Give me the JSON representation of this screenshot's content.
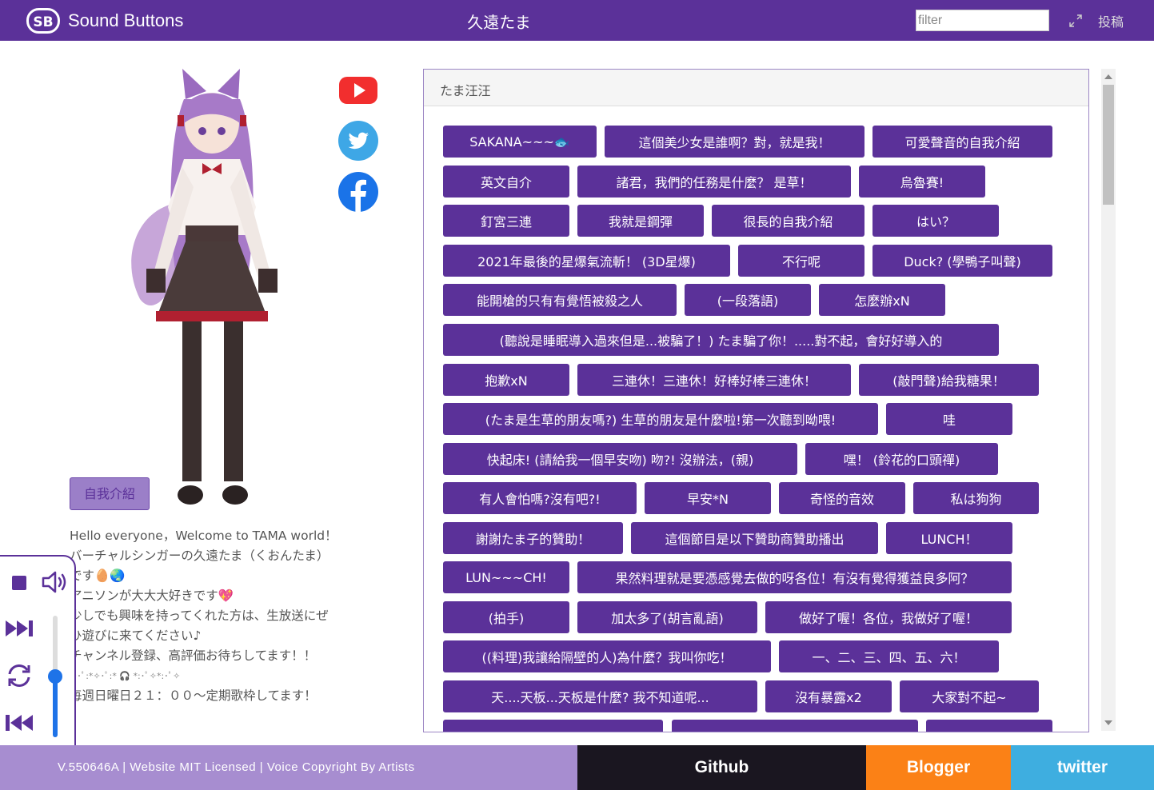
{
  "header": {
    "brand": "Sound Buttons",
    "title": "久遠たま",
    "filter_placeholder": "filter",
    "post_label": "投稿"
  },
  "left": {
    "intro_button": "自我介紹",
    "description": [
      "Hello everyone，Welcome to TAMA world！",
      "バーチャルシンガーの久遠たま（くおんたま）",
      "です🥚🌏",
      "アニソンが大大大好きです💖",
      "少しでも興味を持ってくれた方は、生放送にぜ",
      "ひ遊びに来てください♪",
      "チャンネル登録、高評価お待ちしてます！！",
      "✧･ﾟ:*✧･ﾟ:* 🎧 *:･ﾟ✧*:･ﾟ✧",
      "毎週日曜日２１：００～定期歌枠してます！"
    ]
  },
  "player": {
    "volume": 0.5
  },
  "panel": {
    "title": "たま汪汪",
    "buttons": [
      "SAKANA~~~🐟",
      "這個美少女是誰啊？對，就是我！",
      "可愛聲音的自我介紹",
      "英文自介",
      "諸君，我們的任務是什麼？ 是草！",
      "烏魯賽!",
      "釘宮三連",
      "我就是鋼彈",
      "很長的自我介紹",
      "はい？",
      "2021年最後的星爆氣流斬！ (3D星爆)",
      "不行呢",
      "Duck? (學鴨子叫聲)",
      "能開槍的只有有覺悟被殺之人",
      "(一段落語)",
      "怎麼辦xN",
      "(聽說是睡眠導入過來但是...被騙了！) たま騙了你！.....對不起，會好好導入的",
      "抱歉xN",
      "三連休！三連休！好棒好棒三連休！",
      "(敲門聲)給我糖果！",
      "(たま是生草的朋友嗎?) 生草的朋友是什麼啦!第一次聽到呦喂!",
      "哇",
      "快起床! (請給我一個早安吻) 吻?! 沒辦法，(親)",
      "嘿！ (鈴花的口頭禪)",
      "有人會怕嗎?沒有吧?!",
      "早安*N",
      "奇怪的音效",
      "私は狗狗",
      "謝謝たま子的贊助！",
      "這個節目是以下贊助商贊助播出",
      "LUNCH！",
      "LUN~~~CH!",
      "果然料理就是要憑感覺去做的呀各位！有沒有覺得獲益良多阿？",
      "(拍手)",
      "加太多了(胡言亂語)",
      "做好了喔！各位，我做好了喔！",
      "((料理)我讓給隔壁的人)為什麼？我叫你吃！",
      "一、二、三、四、五、六！",
      "天....天板...天板是什麼? 我不知道呢...",
      "沒有暴露x2",
      "大家對不起~",
      "",
      "",
      ""
    ]
  },
  "footer": {
    "info": "V.550646A | Website MIT Licensed | Voice Copyright By Artists",
    "github": "Github",
    "blogger": "Blogger",
    "twitter": "twitter"
  },
  "colors": {
    "primary": "#5b3199",
    "footer_info_bg": "#a78dd0",
    "github_bg": "#1a1620",
    "blogger_bg": "#fb8116",
    "twitter_bg": "#3eaee0"
  }
}
